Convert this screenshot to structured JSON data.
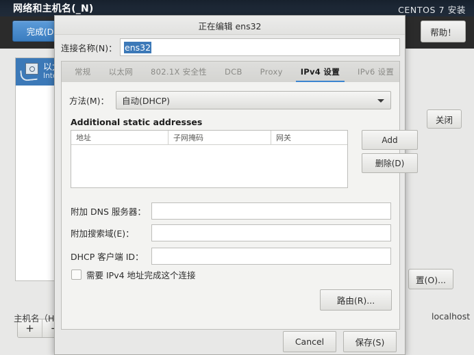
{
  "installer": {
    "header_title": "网络和主机名(_N)",
    "brand": "CENTOS 7 安装",
    "done_button": "完成(D)",
    "help_button": "帮助！",
    "close_button": "关闭",
    "configure_button": "置(O)...",
    "hostname_label": "主机名（H）",
    "hostname_value": "localhost",
    "add_device": "+",
    "remove_device": "−",
    "device": {
      "name": "以太",
      "detail": "Intel"
    }
  },
  "dialog": {
    "title": "正在编辑 ens32",
    "connection_name_label": "连接名称(N)：",
    "connection_name_value": "ens32",
    "tabs": [
      {
        "label": "常规",
        "active": false
      },
      {
        "label": "以太网",
        "active": false
      },
      {
        "label": "802.1X 安全性",
        "active": false
      },
      {
        "label": "DCB",
        "active": false
      },
      {
        "label": "Proxy",
        "active": false
      },
      {
        "label": "IPv4 设置",
        "active": true
      },
      {
        "label": "IPv6 设置",
        "active": false
      }
    ],
    "method_label": "方法(M)：",
    "method_value": "自动(DHCP)",
    "section_title": "Additional static addresses",
    "table": {
      "columns": [
        "地址",
        "子网掩码",
        "网关"
      ],
      "rows": []
    },
    "add_button": "Add",
    "delete_button": "删除(D)",
    "dns_label": "附加 DNS 服务器：",
    "dns_value": "",
    "search_label": "附加搜索域(E)：",
    "search_value": "",
    "client_id_label": "DHCP 客户端 ID：",
    "client_id_value": "",
    "require_ipv4_label": "需要 IPv4 地址完成这个连接",
    "require_ipv4_checked": false,
    "routes_button": "路由(R)...",
    "cancel_button": "Cancel",
    "save_button": "保存(S)"
  },
  "colors": {
    "accent": "#3c85d0",
    "selection": "#3c79b8",
    "header_bg": "#1d2836",
    "toolbar_bg": "#2b2b2b",
    "dialog_bg": "#e8e8e7"
  }
}
